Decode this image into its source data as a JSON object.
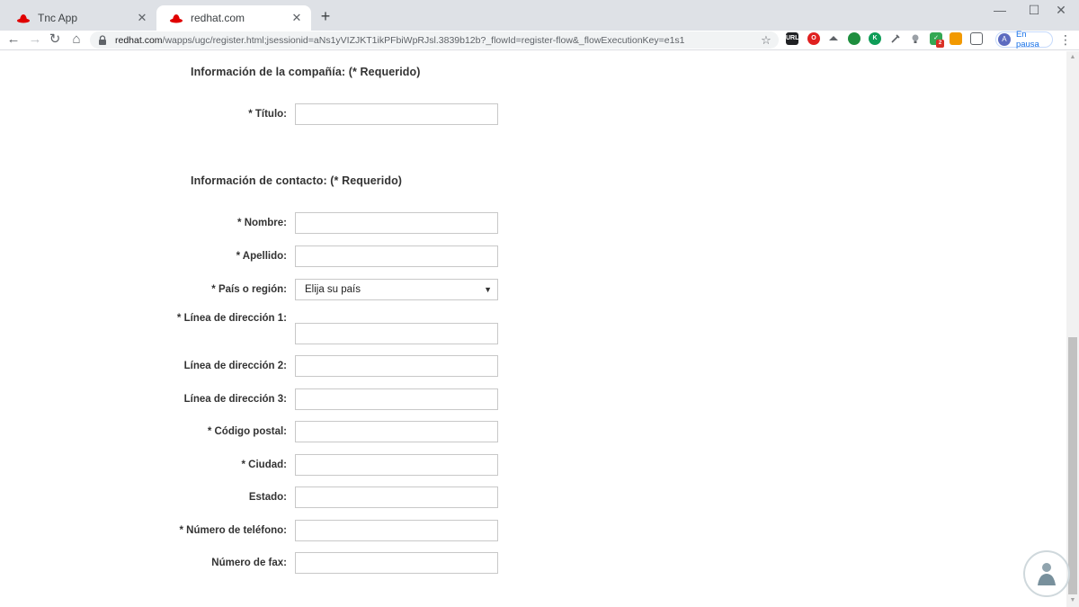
{
  "tabs": [
    {
      "title": "Tnc App",
      "active": false
    },
    {
      "title": "redhat.com",
      "active": true
    }
  ],
  "window_controls": {
    "minimize": "—",
    "maximize": "☐",
    "close": "✕"
  },
  "address_bar": {
    "host": "redhat.com",
    "path": "/wapps/ugc/register.html;jsessionid=aNs1yVIZJKT1ikPFbiWpRJsl.3839b12b?_flowId=register-flow&_flowExecutionKey=e1s1"
  },
  "profile": {
    "initial": "A",
    "label": "En pausa"
  },
  "extensions": [
    {
      "name": "url-ext-icon",
      "text": "URL",
      "color": "#202124"
    },
    {
      "name": "opera-ext-icon",
      "text": "O",
      "color": "#e02020"
    },
    {
      "name": "hat-ext-icon",
      "text": "",
      "color": "#5f6368"
    },
    {
      "name": "green-ext-icon",
      "text": "",
      "color": "#1e8e3e"
    },
    {
      "name": "k-ext-icon",
      "text": "K",
      "color": "#0f9d58"
    },
    {
      "name": "dropper-ext-icon",
      "text": "",
      "color": "#5f6368"
    },
    {
      "name": "bulb-ext-icon",
      "text": "",
      "color": "#5f6368"
    },
    {
      "name": "check-ext-icon",
      "text": "✓",
      "color": "#34a853"
    },
    {
      "name": "orange-ext-icon",
      "text": "",
      "color": "#f29900"
    },
    {
      "name": "window-ext-icon",
      "text": "",
      "color": "#5f6368"
    }
  ],
  "extension_badge": "2",
  "form": {
    "company_heading": "Información de la compañía: (* Requerido)",
    "contact_heading": "Información de contacto: (* Requerido)",
    "fields": {
      "titulo": "* Título:",
      "nombre": "* Nombre:",
      "apellido": "* Apellido:",
      "pais": "* País o región:",
      "linea1": "* Línea de dirección 1:",
      "linea2": "Línea de dirección 2:",
      "linea3": "Línea de dirección 3:",
      "codigo_postal": "* Código postal:",
      "ciudad": "* Ciudad:",
      "estado": "Estado:",
      "telefono": "* Número de teléfono:",
      "fax": "Número de fax:"
    },
    "pais_selected": "Elija su país"
  },
  "colors": {
    "accent": "#1a73e8",
    "redhat": "#e00000"
  }
}
